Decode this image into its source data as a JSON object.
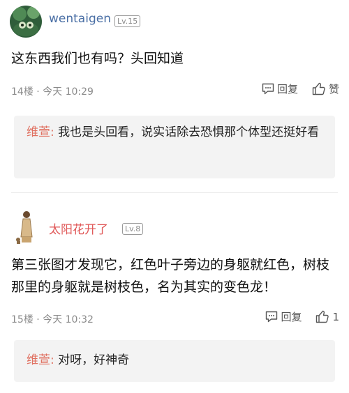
{
  "comments": [
    {
      "username": "wentaigen",
      "level": "Lv.15",
      "content": "这东西我们也有吗？头回知道",
      "meta": "14楼 · 今天 10:29",
      "reply_label": "回复",
      "like_label": "赞",
      "sub_reply": {
        "name": "维萱:",
        "text": " 我也是头回看，说实话除去恐惧那个体型还挺好看"
      }
    },
    {
      "username": "太阳花开了",
      "level": "Lv.8",
      "content": "第三张图才发现它，红色叶子旁边的身躯就红色，树枝那里的身躯就是树枝色，名为其实的变色龙！",
      "meta": "15楼 · 今天 10:32",
      "reply_label": "回复",
      "like_count": "1",
      "sub_reply": {
        "name": "维萱:",
        "text": " 对呀，好神奇"
      }
    }
  ]
}
